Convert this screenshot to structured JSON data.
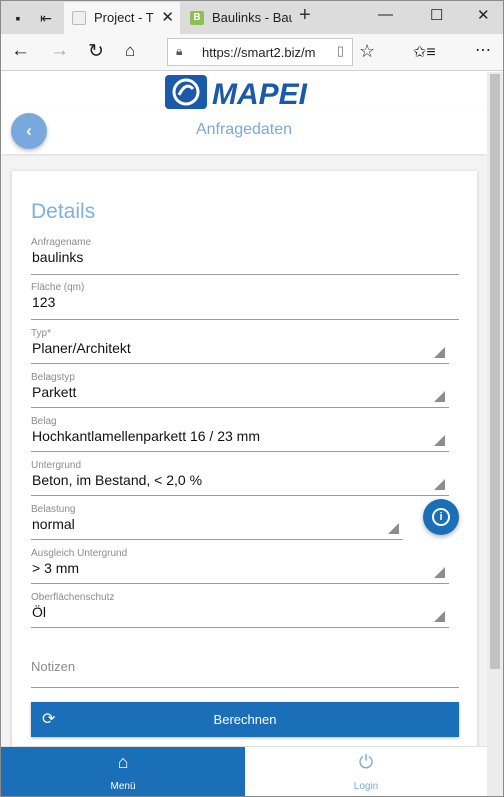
{
  "browser": {
    "tabs": [
      {
        "title": "Project - T",
        "active": true
      },
      {
        "title": "Baulinks - Bau",
        "active": false
      }
    ],
    "url": "https://smart2.biz/m"
  },
  "app": {
    "logo_text": "MAPEI",
    "page_title": "Anfragedaten",
    "section_title": "Details",
    "fields": [
      {
        "label": "Anfragename",
        "value": "baulinks",
        "dropdown": false
      },
      {
        "label": "Fläche (qm)",
        "value": "123",
        "dropdown": false
      },
      {
        "label": "Typ*",
        "value": "Planer/Architekt",
        "dropdown": true
      },
      {
        "label": "Belagstyp",
        "value": "Parkett",
        "dropdown": true
      },
      {
        "label": "Belag",
        "value": "Hochkantlamellenparkett 16 / 23 mm",
        "dropdown": true
      },
      {
        "label": "Untergrund",
        "value": "Beton, im Bestand, < 2,0 %",
        "dropdown": true
      },
      {
        "label": "Belastung",
        "value": "normal",
        "dropdown": true
      },
      {
        "label": "Ausgleich Untergrund",
        "value": "> 3 mm",
        "dropdown": true
      },
      {
        "label": "Oberflächenschutz",
        "value": "Öl",
        "dropdown": true
      }
    ],
    "notes_placeholder": "Notizen",
    "calc_button": "Berechnen",
    "nav": {
      "menu": "Menü",
      "login": "Login"
    }
  },
  "icons": {
    "back": "chevron-left-icon",
    "info": "info-icon",
    "refresh": "refresh-icon",
    "home": "home-icon",
    "power": "power-icon"
  },
  "colors": {
    "brand_blue": "#1b6eb8",
    "light_blue": "#79a9dc"
  }
}
